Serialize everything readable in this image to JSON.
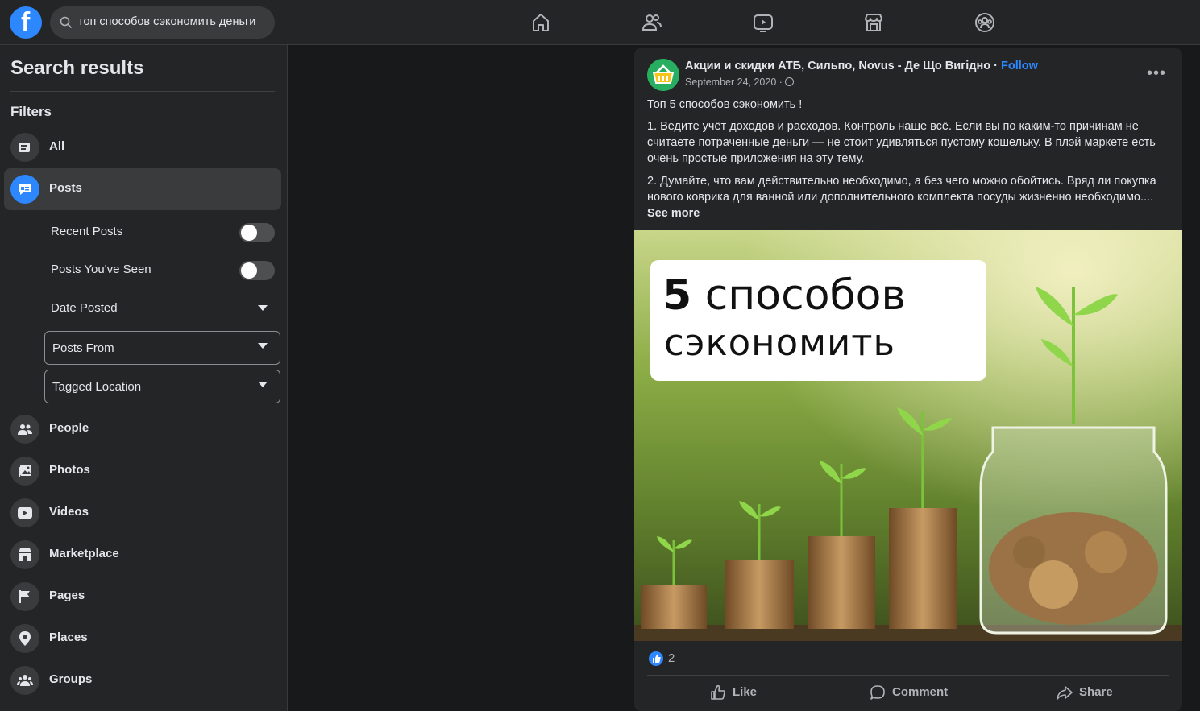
{
  "search": {
    "query": "топ способов сэкономить деньги"
  },
  "sidebar": {
    "title": "Search results",
    "filters_title": "Filters",
    "items": [
      {
        "label": "All"
      },
      {
        "label": "Posts"
      },
      {
        "label": "People"
      },
      {
        "label": "Photos"
      },
      {
        "label": "Videos"
      },
      {
        "label": "Marketplace"
      },
      {
        "label": "Pages"
      },
      {
        "label": "Places"
      },
      {
        "label": "Groups"
      }
    ],
    "post_filters": {
      "recent_posts": "Recent Posts",
      "posts_seen": "Posts You've Seen",
      "date_posted": "Date Posted",
      "posts_from": "Posts From",
      "tagged_location": "Tagged Location"
    }
  },
  "post": {
    "page_name": "Акции и скидки АТБ, Сильпо, Novus - Де Що Вигідно",
    "separator": "·",
    "follow": "Follow",
    "date": "September 24, 2020 ·",
    "title_line": "Топ 5 способов сэкономить !",
    "paragraph1": "1. Ведите учёт доходов и расходов. Контроль наше всё. Если вы по каким-то причинам не считаете потраченные деньги — не стоит удивляться пустому кошельку. В плэй маркете есть очень простые приложения на эту тему.",
    "paragraph2": "2. Думайте, что вам действительно необходимо, а без чего можно обойтись. Вряд ли покупка нового коврика для ванной или дополнительного комплекта посуды жизненно необходимо....",
    "see_more": "See more",
    "image_caption_number": "5",
    "image_caption_line1": "способов",
    "image_caption_line2": "сэкономить",
    "reactions_count": "2",
    "actions": {
      "like": "Like",
      "comment": "Comment",
      "share": "Share"
    }
  },
  "colors": {
    "accent": "#2d88ff",
    "background": "#18191a",
    "surface": "#242526"
  }
}
